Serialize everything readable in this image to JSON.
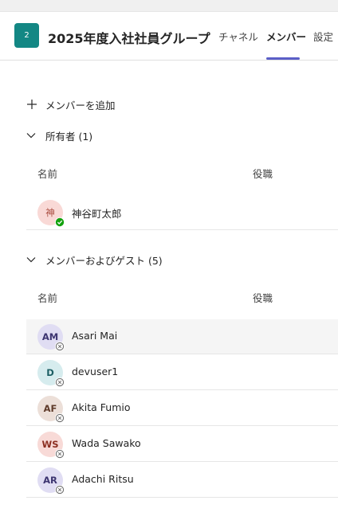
{
  "header": {
    "team_initial": "2",
    "team_name": "2025年度入社社員グループ",
    "tabs": [
      {
        "label": "チャネル",
        "active": false
      },
      {
        "label": "メンバー",
        "active": true
      },
      {
        "label": "設定",
        "active": false
      }
    ]
  },
  "actions": {
    "add_member_label": "メンバーを追加"
  },
  "owners": {
    "label": "所有者 (1)",
    "col_name": "名前",
    "col_role": "役職",
    "members": [
      {
        "initials": "神",
        "name": "神谷町太郎",
        "presence": "available"
      }
    ]
  },
  "guests": {
    "label": "メンバーおよびゲスト (5)",
    "col_name": "名前",
    "col_role": "役職",
    "members": [
      {
        "initials": "AM",
        "name": "Asari Mai",
        "presence": "offline"
      },
      {
        "initials": "D",
        "name": "devuser1",
        "presence": "offline"
      },
      {
        "initials": "AF",
        "name": "Akita Fumio",
        "presence": "offline"
      },
      {
        "initials": "WS",
        "name": "Wada Sawako",
        "presence": "offline"
      },
      {
        "initials": "AR",
        "name": "Adachi Ritsu",
        "presence": "offline"
      }
    ]
  },
  "colors": {
    "team_avatar": "#138784",
    "accent": "#5b5fc7",
    "presence_available": "#13a10e",
    "presence_offline": "#707070",
    "avatar_owner_bg": "#f9d9d6",
    "avatar_owner_fg": "#a94a3d",
    "avatar_purple_bg": "#e0ddf3",
    "avatar_purple_fg": "#3c3470",
    "avatar_teal_bg": "#d6ecee",
    "avatar_teal_fg": "#1d5f64",
    "avatar_brown_bg": "#ecdfd8",
    "avatar_brown_fg": "#5f3b2a",
    "avatar_pink_bg": "#f8dad7",
    "avatar_pink_fg": "#8c2f22"
  }
}
